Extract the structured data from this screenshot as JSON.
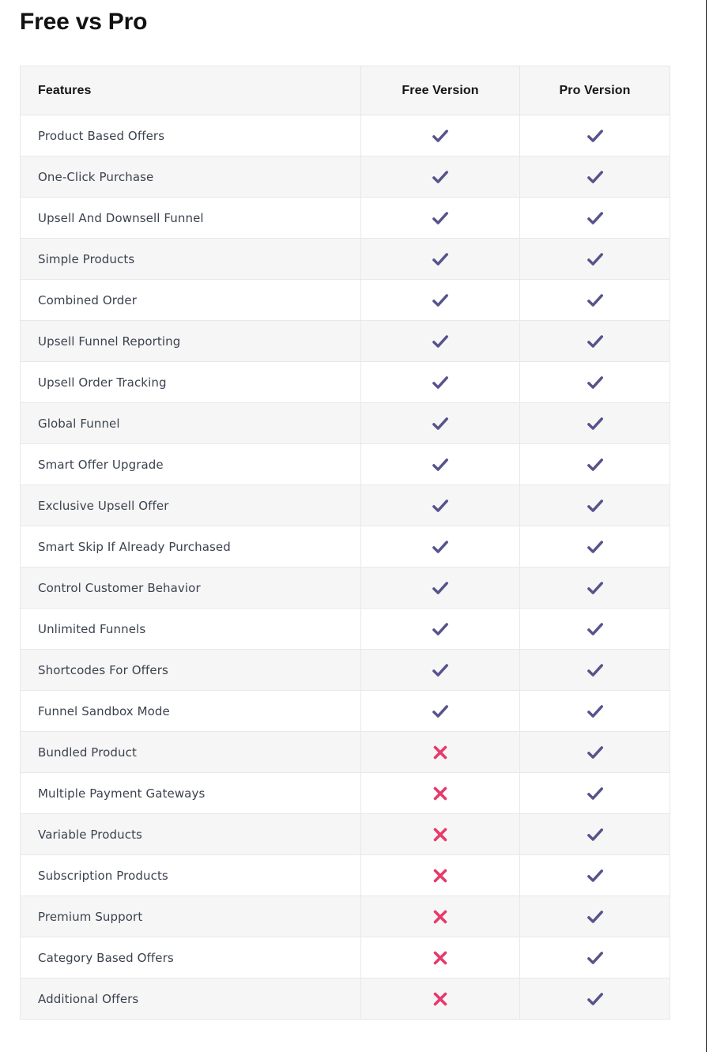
{
  "page": {
    "title": "Free vs Pro"
  },
  "colors": {
    "check": "#56538c",
    "cross": "#e8396b",
    "header_bg": "#f6f6f6",
    "stripe_bg": "#f6f6f6",
    "border": "#e6e6e6",
    "title_text": "#111111",
    "body_text": "#3b424e"
  },
  "table": {
    "columns": [
      {
        "key": "feature",
        "label": "Features",
        "align": "left"
      },
      {
        "key": "free",
        "label": "Free Version",
        "align": "center"
      },
      {
        "key": "pro",
        "label": "Pro Version",
        "align": "center"
      }
    ],
    "rows": [
      {
        "feature": "Product Based Offers",
        "free": "check",
        "pro": "check"
      },
      {
        "feature": "One-Click Purchase",
        "free": "check",
        "pro": "check"
      },
      {
        "feature": "Upsell And Downsell Funnel",
        "free": "check",
        "pro": "check"
      },
      {
        "feature": "Simple Products",
        "free": "check",
        "pro": "check"
      },
      {
        "feature": "Combined Order",
        "free": "check",
        "pro": "check"
      },
      {
        "feature": "Upsell Funnel Reporting",
        "free": "check",
        "pro": "check"
      },
      {
        "feature": "Upsell Order Tracking",
        "free": "check",
        "pro": "check"
      },
      {
        "feature": "Global Funnel",
        "free": "check",
        "pro": "check"
      },
      {
        "feature": "Smart Offer Upgrade",
        "free": "check",
        "pro": "check"
      },
      {
        "feature": "Exclusive Upsell Offer",
        "free": "check",
        "pro": "check"
      },
      {
        "feature": "Smart Skip If Already Purchased",
        "free": "check",
        "pro": "check"
      },
      {
        "feature": "Control Customer Behavior",
        "free": "check",
        "pro": "check"
      },
      {
        "feature": "Unlimited Funnels",
        "free": "check",
        "pro": "check"
      },
      {
        "feature": "Shortcodes For Offers",
        "free": "check",
        "pro": "check"
      },
      {
        "feature": "Funnel Sandbox Mode",
        "free": "check",
        "pro": "check"
      },
      {
        "feature": "Bundled Product",
        "free": "cross",
        "pro": "check"
      },
      {
        "feature": "Multiple Payment Gateways",
        "free": "cross",
        "pro": "check"
      },
      {
        "feature": "Variable Products",
        "free": "cross",
        "pro": "check"
      },
      {
        "feature": "Subscription Products",
        "free": "cross",
        "pro": "check"
      },
      {
        "feature": "Premium Support",
        "free": "cross",
        "pro": "check"
      },
      {
        "feature": "Category Based Offers",
        "free": "cross",
        "pro": "check"
      },
      {
        "feature": "Additional Offers",
        "free": "cross",
        "pro": "check"
      }
    ]
  },
  "icons": {
    "check": "check-icon",
    "cross": "cross-icon"
  }
}
